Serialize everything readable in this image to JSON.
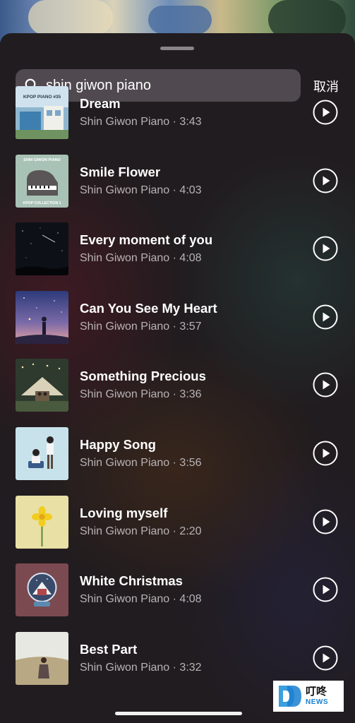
{
  "search": {
    "query": "shin giwon piano",
    "cancel_label": "取消"
  },
  "tracks": [
    {
      "title": "Dream",
      "artist": "Shin Giwon Piano",
      "duration": "3:43",
      "cover_text": "KPOP PIANO #35",
      "cover_sub": ""
    },
    {
      "title": "Smile Flower",
      "artist": "Shin Giwon Piano",
      "duration": "4:03",
      "cover_text": "SHIN GIWON PIANO",
      "cover_sub": "KPOP COLLECTION 1"
    },
    {
      "title": "Every moment of you",
      "artist": "Shin Giwon Piano",
      "duration": "4:08",
      "cover_text": "",
      "cover_sub": ""
    },
    {
      "title": "Can You See My Heart",
      "artist": "Shin Giwon Piano",
      "duration": "3:57",
      "cover_text": "",
      "cover_sub": ""
    },
    {
      "title": "Something Precious",
      "artist": "Shin Giwon Piano",
      "duration": "3:36",
      "cover_text": "",
      "cover_sub": ""
    },
    {
      "title": "Happy Song",
      "artist": "Shin Giwon Piano",
      "duration": "3:56",
      "cover_text": "",
      "cover_sub": ""
    },
    {
      "title": "Loving myself",
      "artist": "Shin Giwon Piano",
      "duration": "2:20",
      "cover_text": "",
      "cover_sub": ""
    },
    {
      "title": "White Christmas",
      "artist": "Shin Giwon Piano",
      "duration": "4:08",
      "cover_text": "",
      "cover_sub": ""
    },
    {
      "title": "Best Part",
      "artist": "Shin Giwon Piano",
      "duration": "3:32",
      "cover_text": "",
      "cover_sub": ""
    }
  ],
  "separator": "·",
  "watermark": {
    "cn": "叮咚",
    "en": "NEWS"
  },
  "colors": {
    "text": "#ffffff",
    "subtext": "#b9b3b6",
    "search_bg": "#7a7076"
  }
}
